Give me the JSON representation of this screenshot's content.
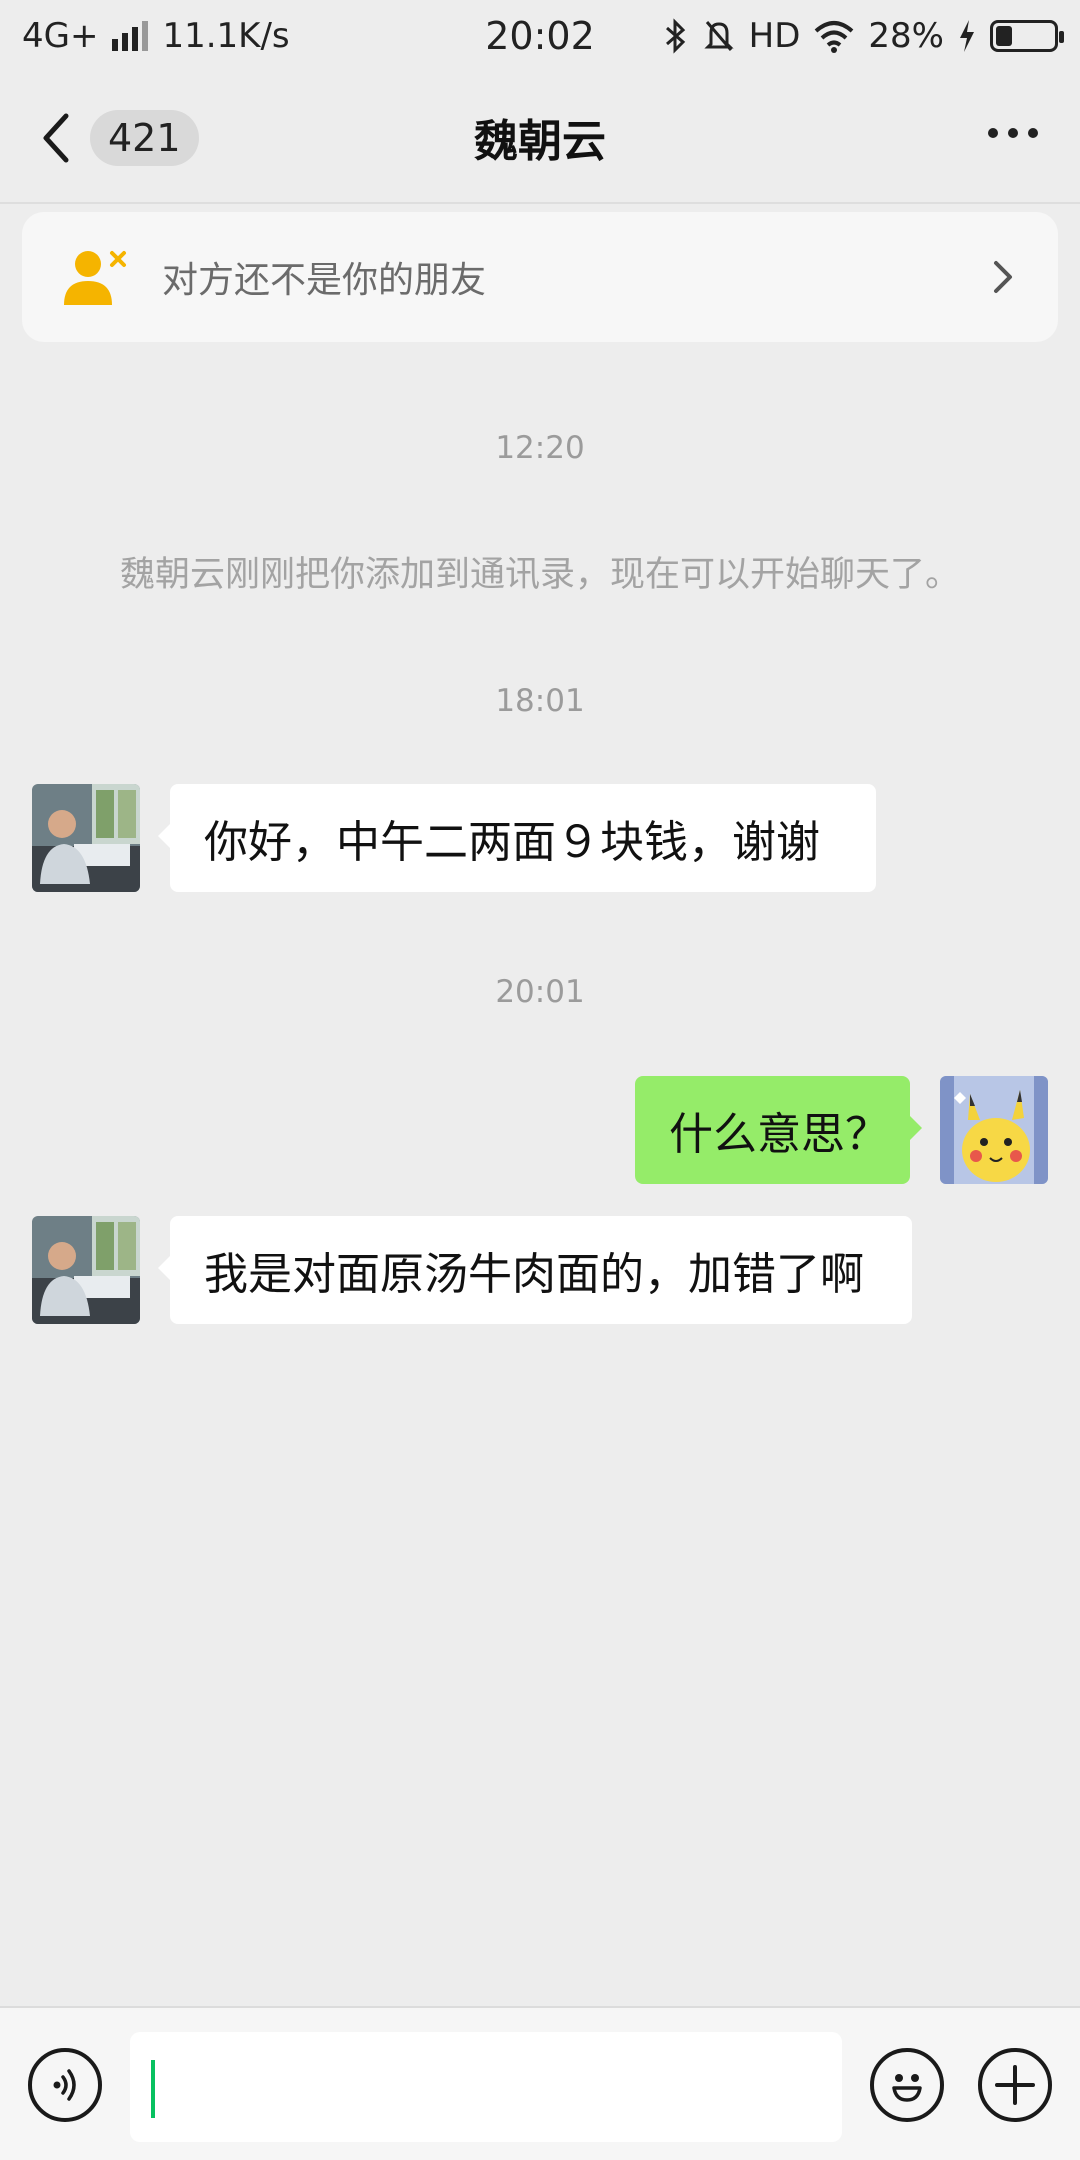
{
  "status_bar": {
    "network": "4G+",
    "speed": "11.1K/s",
    "time": "20:02",
    "hd": "HD",
    "battery_percent": "28%",
    "battery_level": 0.28
  },
  "header": {
    "unread_count": "421",
    "title": "魏朝云"
  },
  "banner": {
    "text": "对方还不是你的朋友",
    "icon": "user-remove-icon",
    "icon_color": "#f5b400"
  },
  "chat": {
    "time_1": "12:20",
    "system_message": "魏朝云刚刚把你添加到通讯录，现在可以开始聊天了。",
    "time_2": "18:01",
    "message_1": "你好，中午二两面９块钱，谢谢",
    "time_3": "20:01",
    "message_2": "什么意思？",
    "message_3": "我是对面原汤牛肉面的，加错了啊"
  },
  "input": {
    "value": "",
    "placeholder": ""
  },
  "colors": {
    "background": "#ededed",
    "outgoing_bubble": "#95ec69",
    "incoming_bubble": "#ffffff",
    "caret": "#07c160"
  }
}
